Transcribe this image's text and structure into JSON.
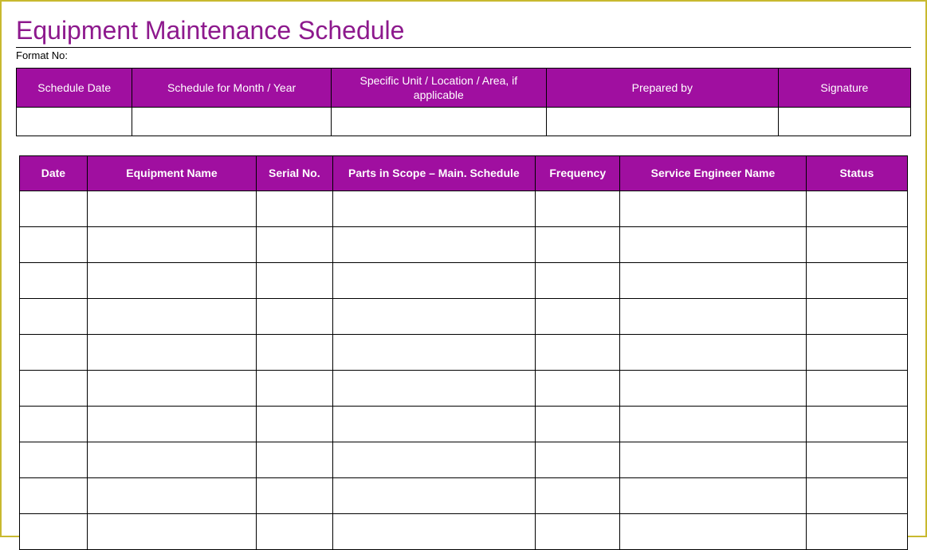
{
  "title": "Equipment Maintenance Schedule",
  "format_label": "Format No:",
  "meta_headers": [
    "Schedule Date",
    "Schedule for Month / Year",
    "Specific Unit / Location  / Area, if applicable",
    "Prepared  by",
    "Signature"
  ],
  "meta_values": [
    "",
    "",
    "",
    "",
    ""
  ],
  "main_headers": [
    "Date",
    "Equipment Name",
    "Serial No.",
    "Parts in Scope – Main. Schedule",
    "Frequency",
    "Service Engineer Name",
    "Status"
  ],
  "main_rows": [
    [
      "",
      "",
      "",
      "",
      "",
      "",
      ""
    ],
    [
      "",
      "",
      "",
      "",
      "",
      "",
      ""
    ],
    [
      "",
      "",
      "",
      "",
      "",
      "",
      ""
    ],
    [
      "",
      "",
      "",
      "",
      "",
      "",
      ""
    ],
    [
      "",
      "",
      "",
      "",
      "",
      "",
      ""
    ],
    [
      "",
      "",
      "",
      "",
      "",
      "",
      ""
    ],
    [
      "",
      "",
      "",
      "",
      "",
      "",
      ""
    ],
    [
      "",
      "",
      "",
      "",
      "",
      "",
      ""
    ],
    [
      "",
      "",
      "",
      "",
      "",
      "",
      ""
    ],
    [
      "",
      "",
      "",
      "",
      "",
      "",
      ""
    ]
  ]
}
